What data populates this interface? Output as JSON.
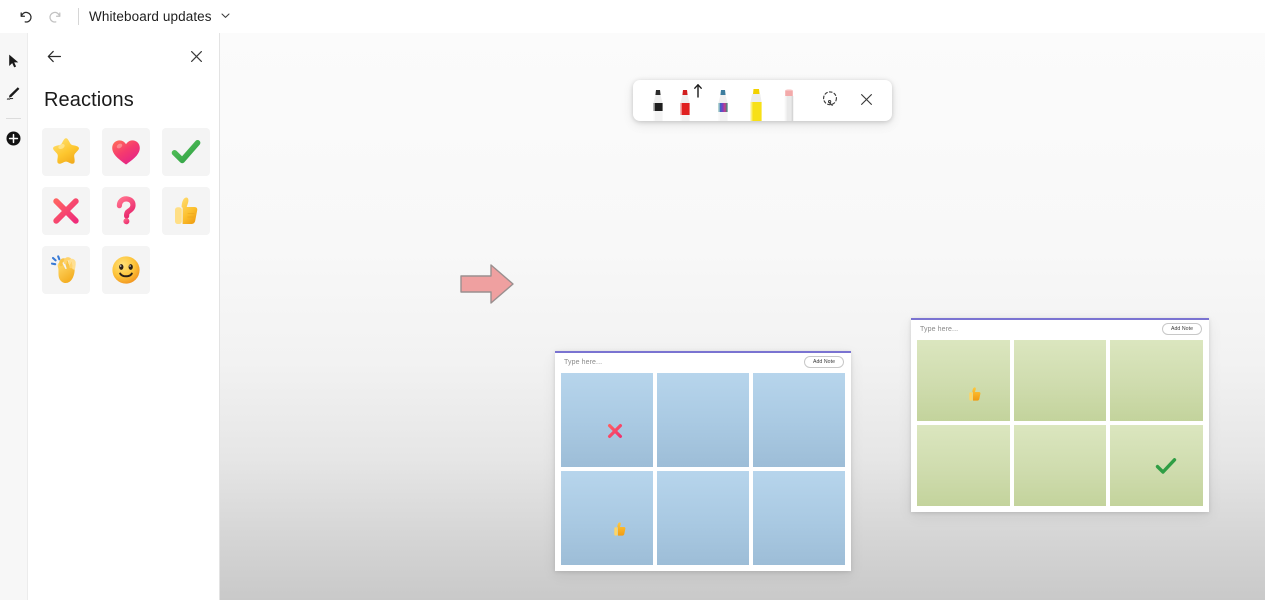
{
  "window": {
    "title": "Whiteboard updates"
  },
  "topbar": {
    "undo_label": "Undo",
    "redo_label": "Redo",
    "doc_title": "Whiteboard updates",
    "chevron_icon": "chevron-down-icon",
    "undo_icon": "undo-icon",
    "redo_icon": "redo-icon"
  },
  "rail": {
    "items": [
      {
        "name": "select-tool",
        "icon": "cursor-arrow-icon",
        "label": "Select",
        "active": false
      },
      {
        "name": "ink-tool",
        "icon": "pen-icon",
        "label": "Ink",
        "active": true
      },
      {
        "name": "add-tool",
        "icon": "plus-circle-icon",
        "label": "Create",
        "active": false
      }
    ]
  },
  "panel": {
    "title": "Reactions",
    "back_label": "Back",
    "back_icon": "arrow-left-icon",
    "close_label": "Close",
    "close_icon": "close-icon",
    "reactions": [
      {
        "name": "reaction-star",
        "icon": "star-emoji",
        "label": "Star"
      },
      {
        "name": "reaction-heart",
        "icon": "heart-emoji",
        "label": "Heart"
      },
      {
        "name": "reaction-check",
        "icon": "check-emoji",
        "label": "Check mark"
      },
      {
        "name": "reaction-cross",
        "icon": "cross-emoji",
        "label": "Cross mark"
      },
      {
        "name": "reaction-question",
        "icon": "question-emoji",
        "label": "Question mark"
      },
      {
        "name": "reaction-thumbsup",
        "icon": "thumbs-up-emoji",
        "label": "Thumbs up"
      },
      {
        "name": "reaction-clap",
        "icon": "clapping-emoji",
        "label": "Clapping hands"
      },
      {
        "name": "reaction-smile",
        "icon": "smiley-emoji",
        "label": "Smiling face"
      }
    ]
  },
  "pen_toolbar": {
    "tools": [
      {
        "name": "pen-black",
        "icon": "pen-black-icon",
        "label": "Black pen",
        "color": "#1a1a1a",
        "selected": false
      },
      {
        "name": "pen-red",
        "icon": "pen-red-icon",
        "label": "Red pen",
        "color": "#e02020",
        "selected": true
      },
      {
        "name": "pen-rainbow",
        "icon": "pen-rainbow-icon",
        "label": "Rainbow pen",
        "color": "#4a7fc1",
        "selected": false
      },
      {
        "name": "highlighter-yellow",
        "icon": "highlighter-icon",
        "label": "Yellow highlighter",
        "color": "#f7e017",
        "selected": false
      },
      {
        "name": "eraser",
        "icon": "eraser-icon",
        "label": "Eraser",
        "color": "#f0a8a8",
        "selected": false
      }
    ],
    "lasso_label": "Lasso select",
    "lasso_icon": "lasso-select-icon",
    "close_label": "Close ink toolbar",
    "close_icon": "close-icon"
  },
  "canvas": {
    "arrow_annotation": {
      "name": "arrow-annotation",
      "label": "Pink right arrow",
      "fill": "#efa0a0",
      "stroke": "#9a8f8f",
      "direction": "right"
    },
    "boards": [
      {
        "name": "board-blue",
        "placeholder": "Type here...",
        "add_note_label": "Add Note",
        "accent_color": "#7a73d1",
        "note_color": "#b7d5ec",
        "notes": [
          {
            "name": "note-1",
            "reaction": "cross-emoji"
          },
          {
            "name": "note-2",
            "reaction": null
          },
          {
            "name": "note-3",
            "reaction": null
          },
          {
            "name": "note-4",
            "reaction": "thumbs-up-emoji"
          },
          {
            "name": "note-5",
            "reaction": null
          },
          {
            "name": "note-6",
            "reaction": null
          }
        ]
      },
      {
        "name": "board-green",
        "placeholder": "Type here...",
        "add_note_label": "Add Note",
        "accent_color": "#7a73d1",
        "note_color": "#cfdcae",
        "notes": [
          {
            "name": "note-1",
            "reaction": "thumbs-up-emoji"
          },
          {
            "name": "note-2",
            "reaction": null
          },
          {
            "name": "note-3",
            "reaction": null
          },
          {
            "name": "note-4",
            "reaction": null
          },
          {
            "name": "note-5",
            "reaction": null
          },
          {
            "name": "note-6",
            "reaction": "check-emoji"
          }
        ]
      }
    ]
  },
  "colors": {
    "accent": "#7a73d1",
    "note_blue": "#b7d5ec",
    "note_green": "#cfdcae",
    "arrow_pink": "#efa0a0",
    "panel_bg": "#ffffff",
    "canvas_top": "#fbfbfb",
    "canvas_bottom": "#c9c9c9"
  }
}
